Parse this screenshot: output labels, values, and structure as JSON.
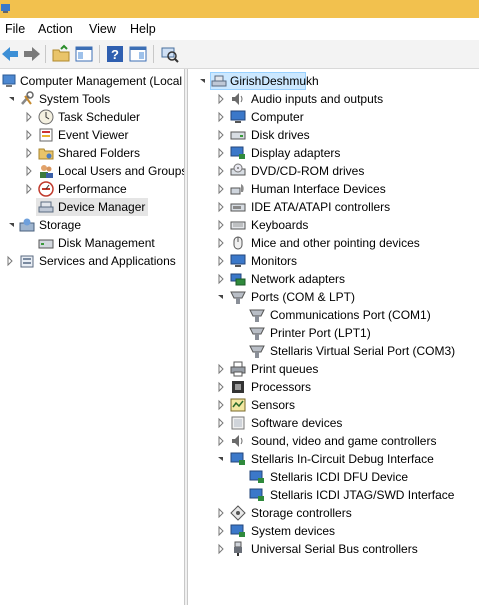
{
  "menu": {
    "file": "File",
    "action": "Action",
    "view": "View",
    "help": "Help"
  },
  "left_tree": {
    "root": "Computer Management (Local",
    "system_tools": "System Tools",
    "task_scheduler": "Task Scheduler",
    "event_viewer": "Event Viewer",
    "shared_folders": "Shared Folders",
    "local_users": "Local Users and Groups",
    "performance": "Performance",
    "device_manager": "Device Manager",
    "storage": "Storage",
    "disk_management": "Disk Management",
    "services": "Services and Applications"
  },
  "right_tree": {
    "root": "GirishDeshmukh",
    "audio": "Audio inputs and outputs",
    "computer": "Computer",
    "disk": "Disk drives",
    "display": "Display adapters",
    "dvd": "DVD/CD-ROM drives",
    "hid": "Human Interface Devices",
    "ide": "IDE ATA/ATAPI controllers",
    "keyboards": "Keyboards",
    "mice": "Mice and other pointing devices",
    "monitors": "Monitors",
    "network": "Network adapters",
    "ports": "Ports (COM & LPT)",
    "com1": "Communications Port (COM1)",
    "lpt1": "Printer Port (LPT1)",
    "com3": "Stellaris Virtual Serial Port (COM3)",
    "printq": "Print queues",
    "processors": "Processors",
    "sensors": "Sensors",
    "software": "Software devices",
    "sound": "Sound, video and game controllers",
    "stellaris_debug": "Stellaris In-Circuit Debug Interface",
    "dfu": "Stellaris ICDI DFU Device",
    "jtag": "Stellaris ICDI JTAG/SWD Interface",
    "storage_ctrl": "Storage controllers",
    "system_devices": "System devices",
    "usb": "Universal Serial Bus controllers"
  }
}
